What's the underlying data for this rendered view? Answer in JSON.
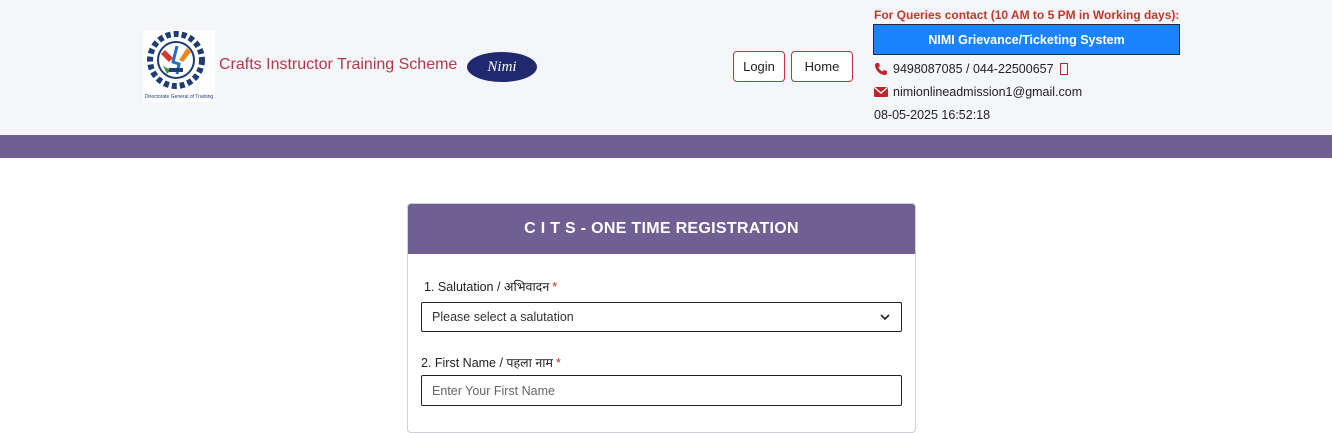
{
  "header": {
    "brand_title": "Crafts Instructor Training Scheme",
    "logo_caption": "Directorate General of Training",
    "nimi_logo_text": "Nimi",
    "login_label": "Login",
    "home_label": "Home",
    "queries_text": "For Queries contact (10 AM to 5 PM in Working days):",
    "grievance_label": "NIMI Grievance/Ticketing System",
    "phone": "9498087085 / 044-22500657",
    "email": "nimionlineadmission1@gmail.com",
    "datetime": "08-05-2025 16:52:18"
  },
  "form": {
    "title": "C I T S - ONE TIME REGISTRATION",
    "salutation_label": "1. Salutation / अभिवादन",
    "salutation_value": "Please select a salutation",
    "first_name_label": "2. First Name / पहला नाम",
    "first_name_placeholder": "Enter Your First Name",
    "required_mark": "*"
  },
  "colors": {
    "accent_purple": "#6f5f93",
    "brand_red": "#b23a48",
    "grievance_blue": "#1a84ff",
    "header_bg": "#f5f6f9"
  },
  "icons": [
    "dgt-logo-icon",
    "phone-icon",
    "envelope-icon",
    "chevron-down-icon"
  ]
}
